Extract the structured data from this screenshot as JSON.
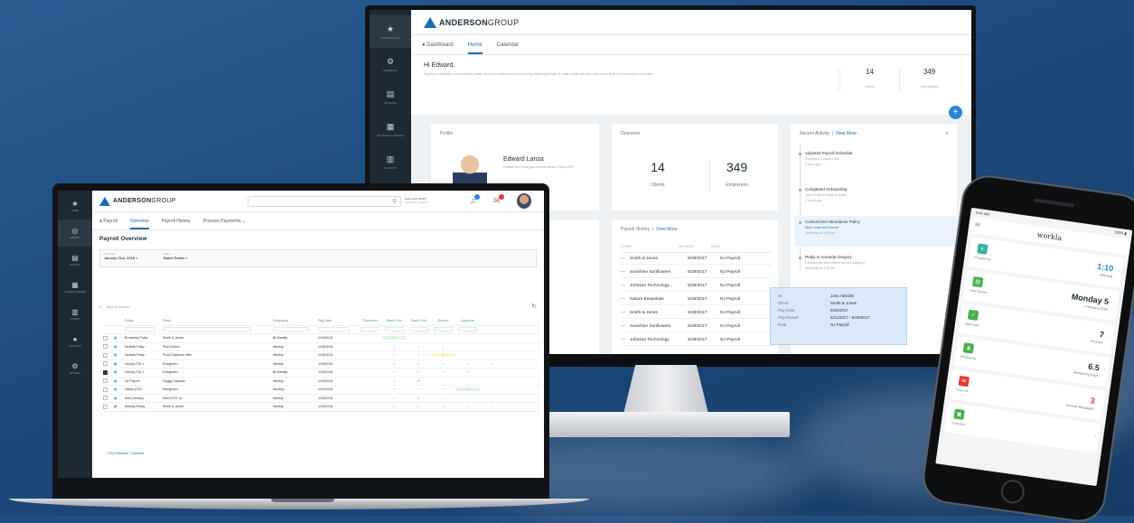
{
  "brand": {
    "name_bold": "ANDERSON",
    "name_light": "GROUP"
  },
  "monitor": {
    "sidebar": [
      {
        "icon": "★",
        "label": "DASHBOARD",
        "active": true
      },
      {
        "icon": "⚙",
        "label": "GENERAL"
      },
      {
        "icon": "▤",
        "label": "PAYROLL"
      },
      {
        "icon": "▦",
        "label": "GENERAL LEDGER"
      },
      {
        "icon": "▥",
        "label": "CLIENTS"
      }
    ],
    "tabs": [
      "Dashboard",
      "Home",
      "Calendar"
    ],
    "greeting": "Hi Edward,",
    "greeting_text": "Spring is officially a few weeks away, but you could start your spring cleaning today. A clean desk will help you cope with the emotions of winter!",
    "stats": [
      {
        "value": "14",
        "label": "clients"
      },
      {
        "value": "349",
        "label": "employees"
      }
    ],
    "fab": "+",
    "profile": {
      "title": "Profile",
      "name": "Edward Lanza",
      "sub": "Edward is a hiding guru and Anderson Group PEO"
    },
    "overview": {
      "title": "Overview",
      "clients_value": "14",
      "clients_label": "Clients",
      "employees_value": "349",
      "employees_label": "Employees"
    },
    "activity": {
      "title": "Recent Activity",
      "view_more": "View More",
      "close": "×",
      "items": [
        {
          "title": "Adjusted Payroll Schedule",
          "sub": "Evergreen Country Club",
          "time": "1 hour ago"
        },
        {
          "title": "Completed Onboarding",
          "sub": "Jane Green in Smith & Jones",
          "time": "2 hours ago"
        },
        {
          "title": "Customized Attendance Policy",
          "sub": "Alert: Learn and Earned",
          "time": "Yesterday at 2:58 pm"
        },
        {
          "title": "Reply to Amanda Gregory",
          "sub": "Followed the extra letters but not making it...",
          "time": "Yesterday at 1:13 pm"
        }
      ]
    },
    "payroll_history": {
      "title": "Payroll History",
      "view_more": "View More",
      "headers": [
        "CLIENT",
        "PAY DATE",
        "RULE"
      ],
      "rows": [
        {
          "client": "Smith & Jones",
          "date": "5/29/2017",
          "rule": "NJ Payroll"
        },
        {
          "client": "Sunshine Sunflowers",
          "date": "5/29/2017",
          "rule": "NJ Payroll"
        },
        {
          "client": "Johnson Technology...",
          "date": "5/29/2017",
          "rule": "NJ Payroll"
        },
        {
          "client": "Nature Essentials",
          "date": "5/29/2017",
          "rule": "NJ Payroll"
        },
        {
          "client": "Smith & Jones",
          "date": "5/29/2017",
          "rule": "NJ Payroll"
        },
        {
          "client": "Sunshine Sunflowers",
          "date": "5/29/2017",
          "rule": "NJ Payroll"
        },
        {
          "client": "Johnson Technology",
          "date": "5/29/2017",
          "rule": "NJ Payroll"
        }
      ]
    },
    "tooltip": [
      {
        "k": "ID",
        "v": "Joe1 ABCDE"
      },
      {
        "k": "Client",
        "v": "Smith & Jones"
      },
      {
        "k": "Pay Date",
        "v": "5/29/2017"
      },
      {
        "k": "Pay Period",
        "v": "5/11/2017 - 5/26/2017"
      },
      {
        "k": "Rule",
        "v": "NJ Payroll"
      }
    ]
  },
  "laptop": {
    "sidebar": [
      {
        "icon": "★",
        "label": "HOME"
      },
      {
        "icon": "◎",
        "label": "GENERAL",
        "active": true
      },
      {
        "icon": "▤",
        "label": "PAYROLL"
      },
      {
        "icon": "▦",
        "label": "GENERAL LEDGER"
      },
      {
        "icon": "▥",
        "label": "CLIENTS"
      },
      {
        "icon": "●",
        "label": "ANALYTICS"
      },
      {
        "icon": "⚙",
        "label": "SETTINGS"
      }
    ],
    "user": "Ednd Lanz (EMP)",
    "user_sub": "Anderson / Payroll",
    "tabs": [
      "Payroll",
      "Overview",
      "Payroll History",
      "Process Payments ⌄"
    ],
    "title": "Payroll Overview",
    "filter_period_label": "Pay Period",
    "filter_period": "January 31st, 2018",
    "filter_status_label": "Status",
    "filter_status": "Batch Roster",
    "search_placeholder": "Type to search",
    "headers": [
      "Policy",
      "Client",
      "Frequency",
      "Pay Date",
      "Timesheet",
      "Batch Gen",
      "Batch Sub",
      "Review",
      "Approval"
    ],
    "rows": [
      {
        "policy": "Bi-weekly Policy",
        "client": "Smith & Jones",
        "freq": "Bi-Weekly",
        "date": "1/15/2018",
        "marks": [
          "✓",
          "",
          "",
          "",
          ""
        ]
      },
      {
        "policy": "Default Policy",
        "client": "Pixel Green",
        "freq": "Weekly",
        "date": "1/15/2018",
        "marks": [
          "✓",
          "✓",
          "✓",
          "",
          ""
        ]
      },
      {
        "policy": "Default Policy",
        "client": "Proof Cadence Web",
        "freq": "Weekly",
        "date": "1/15/2018",
        "marks": [
          "✓",
          "✓",
          "!",
          "",
          ""
        ]
      },
      {
        "policy": "Hourly (TS) 1",
        "client": "Evergreen",
        "freq": "Weekly",
        "date": "1/15/2018",
        "marks": [
          "✓",
          "✓",
          "✓",
          "✓",
          "✓"
        ]
      },
      {
        "policy": "Hourly (TS) 2",
        "client": "Evergreen",
        "freq": "Bi-Weekly",
        "date": "1/15/2018",
        "marks": [
          "✓",
          "✓",
          "✓",
          "✓",
          ""
        ]
      },
      {
        "policy": "NJ Payroll",
        "client": "Doggy Daycare",
        "freq": "Weekly",
        "date": "1/15/2018",
        "marks": [
          "✓",
          "✕",
          "",
          "",
          ""
        ]
      },
      {
        "policy": "Salary (CD)",
        "client": "Evergreen",
        "freq": "Monthly",
        "date": "1/31/2018",
        "marks": [
          "✓",
          "✓",
          "✓",
          "✓",
          ""
        ]
      },
      {
        "policy": "Semi Weekly",
        "client": "Semi EFG Jo",
        "freq": "Weekly",
        "date": "1/15/2018",
        "marks": [
          "✓",
          "✓",
          "◔",
          "",
          ""
        ]
      },
      {
        "policy": "Weekly Policy",
        "client": "Smith & Jones",
        "freq": "Weekly",
        "date": "1/15/2018",
        "marks": [
          "✓",
          "✓",
          "✓",
          "✓",
          "◔"
        ]
      }
    ],
    "footer": "Run Selected: 1 selected"
  },
  "phone": {
    "time": "9:41 AM",
    "battery": "100% ▮",
    "app": "workla",
    "cards": [
      {
        "icon": "◐",
        "label": "Productivity",
        "value": "1:10",
        "sub": "Morning",
        "color": "#3bb0a0"
      },
      {
        "icon": "▤",
        "label": "Time Entries",
        "value": "Monday 5",
        "sub": "February 2018",
        "color": "#4caf50"
      },
      {
        "icon": "✓",
        "label": "Approvals",
        "value": "7",
        "sub": "All Done",
        "color": "#4caf50"
      },
      {
        "icon": "♟",
        "label": "Employees",
        "value": "6.5",
        "sub": "Remaining Days",
        "color": "#4caf50"
      },
      {
        "icon": "✉",
        "label": "Time Off",
        "value": "3",
        "sub": "Unread Messages",
        "color": "#e53935"
      },
      {
        "icon": "▣",
        "label": "Contracts",
        "value": "",
        "sub": "",
        "color": "#4caf50"
      }
    ]
  }
}
